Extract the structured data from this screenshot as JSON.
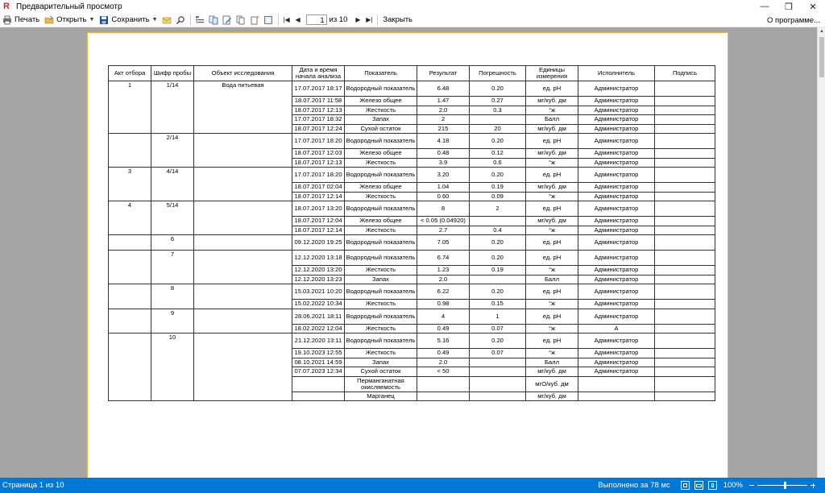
{
  "window": {
    "title": "Предварительный просмотр",
    "minimize": "—",
    "restore": "❐",
    "close": "✕"
  },
  "toolbar": {
    "print_label": "Печать",
    "open_label": "Открыть",
    "save_label": "Сохранить",
    "page_value": "1",
    "of_text": "из 10",
    "close_label": "Закрыть",
    "about_label": "О программе..."
  },
  "colors": {
    "accent": "#0078d7",
    "workspace": "#a5a5a5",
    "page_border": "#f0b83a",
    "logo": "#c4262e"
  },
  "report": {
    "headers": [
      "Акт отбора",
      "Шифр пробы",
      "Объект исследования",
      "Дата и время начала анализа",
      "Показатель",
      "Результат",
      "Погрешность",
      "Единицы измерения",
      "Исполнитель",
      "Подпись"
    ],
    "groups": [
      {
        "act": "1",
        "code": "1/14",
        "object": "Вода питьевая",
        "rows": [
          {
            "date": "17.07.2017 18:17",
            "indicator": "Водородный показатель",
            "result": "6.48",
            "error": "0.20",
            "unit": "ед. pH",
            "executor": "Администратор",
            "sign": ""
          },
          {
            "date": "18.07.2017 11:58",
            "indicator": "Железо общее",
            "result": "1.47",
            "error": "0.27",
            "unit": "мг/куб. дм",
            "executor": "Администратор",
            "sign": ""
          },
          {
            "date": "18.07.2017 12:13",
            "indicator": "Жесткость",
            "result": "2.0",
            "error": "0.3",
            "unit": "°ж",
            "executor": "Администратор",
            "sign": ""
          },
          {
            "date": "17.07.2017 18:32",
            "indicator": "Запах",
            "result": "2",
            "error": "",
            "unit": "Балл",
            "executor": "Администратор",
            "sign": ""
          },
          {
            "date": "18.07.2017 12:24",
            "indicator": "Сухой остаток",
            "result": "215",
            "error": "20",
            "unit": "мг/куб. дм",
            "executor": "Администратор",
            "sign": ""
          }
        ]
      },
      {
        "act": "",
        "code": "2/14",
        "object": "",
        "rows": [
          {
            "date": "17.07.2017 18:20",
            "indicator": "Водородный показатель",
            "result": "4.18",
            "error": "0.20",
            "unit": "ед. pH",
            "executor": "Администратор",
            "sign": ""
          },
          {
            "date": "18.07.2017 12:03",
            "indicator": "Железо общее",
            "result": "0.48",
            "error": "0.12",
            "unit": "мг/куб. дм",
            "executor": "Администратор",
            "sign": ""
          },
          {
            "date": "18.07.2017 12:13",
            "indicator": "Жесткость",
            "result": "3.9",
            "error": "0.6",
            "unit": "°ж",
            "executor": "Администратор",
            "sign": ""
          }
        ]
      },
      {
        "act": "3",
        "code": "4/14",
        "object": "",
        "rows": [
          {
            "date": "17.07.2017 18:20",
            "indicator": "Водородный показатель",
            "result": "3.20",
            "error": "0.20",
            "unit": "ед. pH",
            "executor": "Администратор",
            "sign": ""
          },
          {
            "date": "18.07.2017 02:04",
            "indicator": "Железо общее",
            "result": "1.04",
            "error": "0.19",
            "unit": "мг/куб. дм",
            "executor": "Администратор",
            "sign": ""
          },
          {
            "date": "18.07.2017 12:14",
            "indicator": "Жесткость",
            "result": "0.60",
            "error": "0.09",
            "unit": "°ж",
            "executor": "Администратор",
            "sign": ""
          }
        ]
      },
      {
        "act": "4",
        "code": "5/14",
        "object": "",
        "rows": [
          {
            "date": "18.07.2017 13:20",
            "indicator": "Водородный показатель",
            "result": "8",
            "error": "2",
            "unit": "ед. pH",
            "executor": "Администратор",
            "sign": ""
          },
          {
            "date": "18.07.2017 12:04",
            "indicator": "Железо общее",
            "result": "< 0.05 (0.04920)",
            "error": "",
            "unit": "мг/куб. дм",
            "executor": "Администратор",
            "sign": ""
          },
          {
            "date": "18.07.2017 12:14",
            "indicator": "Жесткость",
            "result": "2.7",
            "error": "0.4",
            "unit": "°ж",
            "executor": "Администратор",
            "sign": ""
          }
        ]
      },
      {
        "act": "",
        "code": "6",
        "object": "",
        "rows": [
          {
            "date": "09.12.2020 19:25",
            "indicator": "Водородный показатель",
            "result": "7.05",
            "error": "0.20",
            "unit": "ед. pH",
            "executor": "Администратор",
            "sign": ""
          }
        ]
      },
      {
        "act": "",
        "code": "7",
        "object": "",
        "rows": [
          {
            "date": "12.12.2020 13:18",
            "indicator": "Водородный показатель",
            "result": "6.74",
            "error": "0.20",
            "unit": "ед. pH",
            "executor": "Администратор",
            "sign": ""
          },
          {
            "date": "12.12.2020 13:20",
            "indicator": "Жесткость",
            "result": "1.23",
            "error": "0.19",
            "unit": "°ж",
            "executor": "Администратор",
            "sign": ""
          },
          {
            "date": "12.12.2020 13:23",
            "indicator": "Запах",
            "result": "2.0",
            "error": "",
            "unit": "Балл",
            "executor": "Администратор",
            "sign": ""
          }
        ]
      },
      {
        "act": "",
        "code": "8",
        "object": "",
        "rows": [
          {
            "date": "15.03.2021 10:20",
            "indicator": "Водородный показатель",
            "result": "6.22",
            "error": "0.20",
            "unit": "ед. pH",
            "executor": "Администратор",
            "sign": ""
          },
          {
            "date": "15.02.2022 10:34",
            "indicator": "Жесткость",
            "result": "0.98",
            "error": "0.15",
            "unit": "°ж",
            "executor": "Администратор",
            "sign": ""
          }
        ]
      },
      {
        "act": "",
        "code": "9",
        "object": "",
        "rows": [
          {
            "date": "28.06.2021 18:11",
            "indicator": "Водородный показатель",
            "result": "4",
            "error": "1",
            "unit": "ед. pH",
            "executor": "Администратор",
            "sign": ""
          },
          {
            "date": "18.02.2022 12:04",
            "indicator": "Жесткость",
            "result": "0.49",
            "error": "0.07",
            "unit": "°ж",
            "executor": "А",
            "sign": ""
          }
        ]
      },
      {
        "act": "",
        "code": "10",
        "object": "",
        "rows": [
          {
            "date": "21.12.2020 13:11",
            "indicator": "Водородный показатель",
            "result": "5.16",
            "error": "0.20",
            "unit": "ед. pH",
            "executor": "Администратор",
            "sign": ""
          },
          {
            "date": "19.10.2023 12:55",
            "indicator": "Жесткость",
            "result": "0.49",
            "error": "0.07",
            "unit": "°ж",
            "executor": "Администратор",
            "sign": ""
          },
          {
            "date": "08.10.2021 14:59",
            "indicator": "Запах",
            "result": "2.0",
            "error": "",
            "unit": "Балл",
            "executor": "Администратор",
            "sign": ""
          },
          {
            "date": "07.07.2023 12:34",
            "indicator": "Сухой остаток",
            "result": "< 50",
            "error": "",
            "unit": "мг/куб. дм",
            "executor": "Администратор",
            "sign": ""
          },
          {
            "date": "",
            "indicator": "Перманганатная окисляемость",
            "result": "",
            "error": "",
            "unit": "мгО/куб. дм",
            "executor": "",
            "sign": ""
          },
          {
            "date": "",
            "indicator": "Марганец",
            "result": "",
            "error": "",
            "unit": "мг/куб. дм",
            "executor": "",
            "sign": ""
          }
        ]
      }
    ]
  },
  "status": {
    "page_text": "Страница 1 из 10",
    "time_text": "Выполнено за 78 мс",
    "zoom_text": "100%",
    "zoom_percent": 100
  }
}
